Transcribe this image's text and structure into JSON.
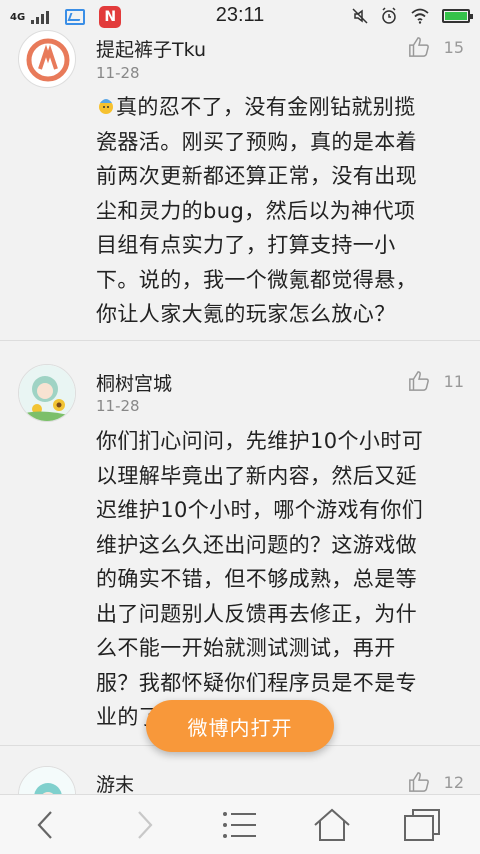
{
  "status_bar": {
    "network": "4G",
    "time": "23:11",
    "app_icon_glyph": "N",
    "icons": [
      "signal-icon",
      "gallery-icon",
      "netease-music-icon",
      "mute-icon",
      "alarm-icon",
      "wifi-icon",
      "battery-icon"
    ],
    "battery_level": 1.0
  },
  "comments": [
    {
      "username": "提起裤子Tku",
      "date": "11-28",
      "likes": "15",
      "text_lines": [
        "真的忍不了，没有金刚钻就别揽",
        "瓷器活。刚买了预购，真的是本着",
        "前两次更新都还算正常，没有出现",
        "尘和灵力的bug，然后以为神代项",
        "目组有点实力了，打算支持一小",
        "下。说的，我一个微氪都觉得悬，",
        "你让人家大氪的玩家怎么放心？"
      ]
    },
    {
      "username": "桐树宫城",
      "date": "11-28",
      "likes": "11",
      "text_lines": [
        "你们扪心问问，先维护10个小时可",
        "以理解毕竟出了新内容，然后又延",
        "迟维护10个小时，哪个游戏有你们",
        "维护这么久还出问题的？这游戏做",
        "的确实不错，但不够成熟，总是等",
        "出了问题别人反馈再去修正，为什",
        "么不能一开始就测试测试，再开",
        "服？我都怀疑你们程序员是不是专",
        "业的了！？"
      ]
    },
    {
      "username": "游末",
      "likes": "12"
    }
  ],
  "open_button": {
    "label": "微博内打开"
  },
  "colors": {
    "accent": "#f8983a",
    "background": "#f2f2f2",
    "battery": "#35c24a"
  }
}
